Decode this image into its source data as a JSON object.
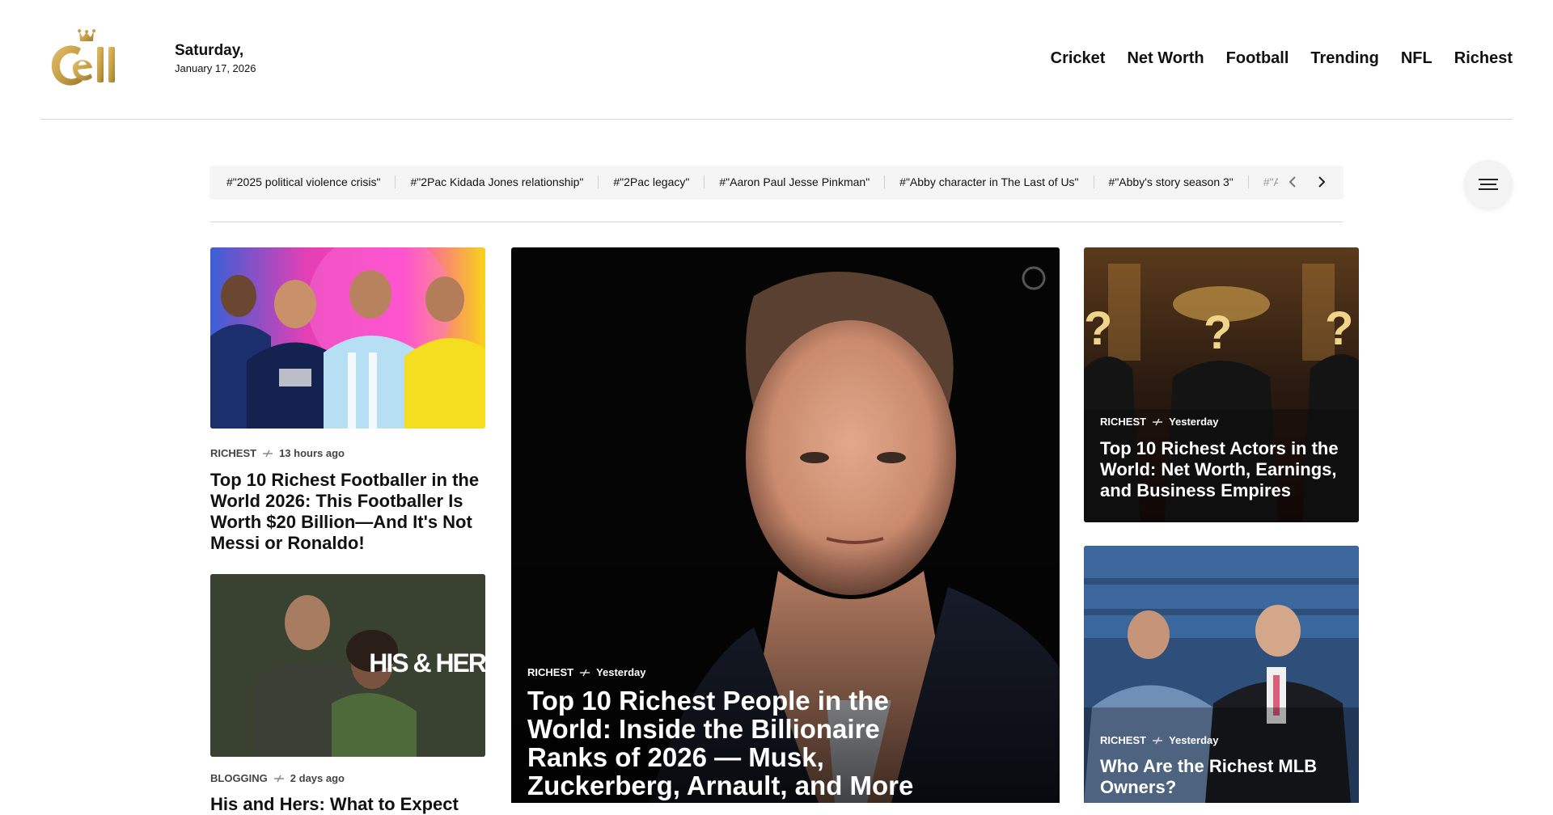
{
  "header": {
    "logo_alt": "Cell logo",
    "date_day": "Saturday,",
    "date_full": "January 17, 2026",
    "nav": [
      "Cricket",
      "Net Worth",
      "Football",
      "Trending",
      "NFL",
      "Richest"
    ]
  },
  "tags": {
    "items": [
      "#\"2025 political violence crisis\"",
      "#\"2Pac Kidada Jones relationship\"",
      "#\"2Pac legacy\"",
      "#\"Aaron Paul Jesse Pinkman\"",
      "#\"Abby character in The Last of Us\"",
      "#\"Abby's story season 3\"",
      "#\"A"
    ],
    "prev_icon": "chevron-left-icon",
    "next_icon": "chevron-right-icon",
    "menu_icon": "hamburger-menu-icon"
  },
  "articles": {
    "left_top": {
      "category": "RICHEST",
      "time": "13 hours ago",
      "title": "Top 10 Richest Footballer in the World 2026: This Footballer Is Worth $20 Billion—And It's Not Messi or Ronaldo!"
    },
    "left_bottom": {
      "category": "BLOGGING",
      "time": "2 days ago",
      "title": "His and Hers: What to Expect",
      "image_text": "HIS & HER"
    },
    "hero": {
      "category": "RICHEST",
      "time": "Yesterday",
      "title": "Top 10 Richest People in the World: Inside the Billionaire Ranks of 2026 — Musk, Zuckerberg, Arnault, and More"
    },
    "right_top": {
      "category": "RICHEST",
      "time": "Yesterday",
      "title": "Top 10 Richest Actors in the World: Net Worth, Earnings, and Business Empires"
    },
    "right_bottom": {
      "category": "RICHEST",
      "time": "Yesterday",
      "title": "Who Are the Richest MLB Owners?"
    }
  },
  "colors": {
    "logo_gold": "#c9a14a",
    "text": "#111111",
    "rule": "#d6d6d6",
    "tagbar_bg": "#f5f5f5"
  }
}
